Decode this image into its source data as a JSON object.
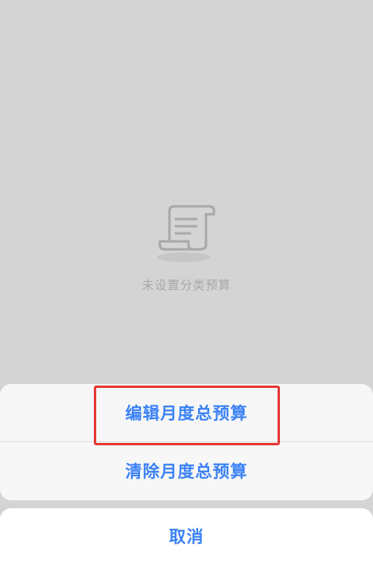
{
  "empty_state": {
    "icon": "receipt-scroll-icon",
    "message": "未设置分类预算"
  },
  "action_sheet": {
    "edit_label": "编辑月度总预算",
    "clear_label": "清除月度总预算",
    "cancel_label": "取消"
  },
  "colors": {
    "overlay": "#d4d4d4",
    "action_text": "#3b82f6",
    "highlight": "#e53935"
  }
}
